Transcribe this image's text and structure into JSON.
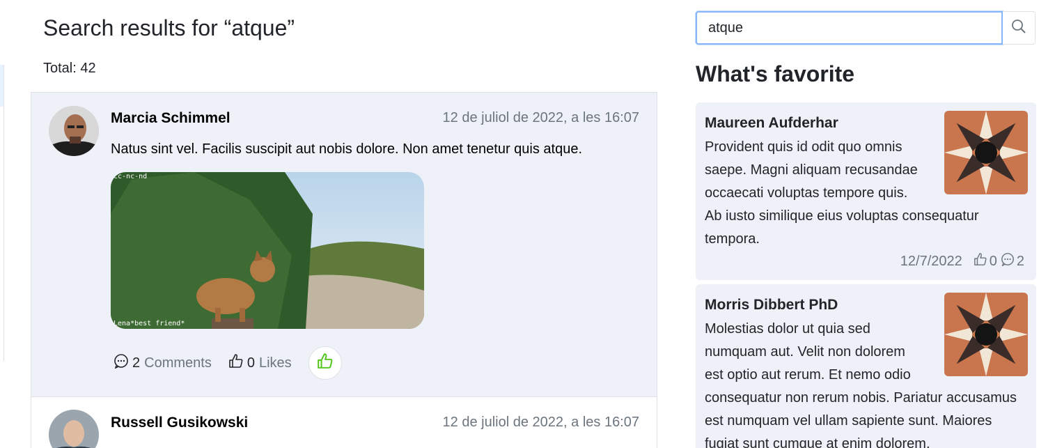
{
  "main": {
    "title": "Search results for “atque”",
    "total": "Total: 42",
    "posts": [
      {
        "author": "Marcia Schimmel",
        "date": "12 de juliol de 2022, a les 16:07",
        "text": "Natus sint vel. Facilis suscipit aut nobis dolore. Non amet tenetur quis atque.",
        "image_caption_top": "cc-nc-nd",
        "image_caption_bottom": "Lena*best friend*",
        "comments_count": "2",
        "comments_label": "Comments",
        "likes_count": "0",
        "likes_label": "Likes"
      },
      {
        "author": "Russell Gusikowski",
        "date": "12 de juliol de 2022, a les 16:07"
      }
    ]
  },
  "sidebar": {
    "search": {
      "value": "atque"
    },
    "favorites_title": "What's favorite",
    "cards": [
      {
        "author": "Maureen Aufderhar",
        "lines": [
          "Provident quis id odit quo omnis",
          "saepe. Magni aliquam recusandae",
          "occaecati voluptas tempore quis.",
          "Ab iusto similique eius voluptas consequatur",
          "tempora."
        ],
        "date": "12/7/2022",
        "likes": "0",
        "comments": "2"
      },
      {
        "author": "Morris Dibbert PhD",
        "lines": [
          "Molestias dolor ut quia sed",
          "numquam aut. Velit non dolorem",
          "est optio aut rerum. Et nemo odio",
          "consequatur non rerum nobis. Pariatur accusamus",
          "est numquam vel ullam sapiente sunt. Maiores",
          "fugiat sunt cumque at enim dolorem."
        ]
      }
    ]
  },
  "icons": {
    "search": "search-icon",
    "comment": "comment-icon",
    "like": "thumbs-up-icon"
  },
  "colors": {
    "card_bg": "#eef1f8",
    "muted": "#6c757d",
    "like_green": "#52c41a",
    "focus_border": "#86b7fe"
  }
}
